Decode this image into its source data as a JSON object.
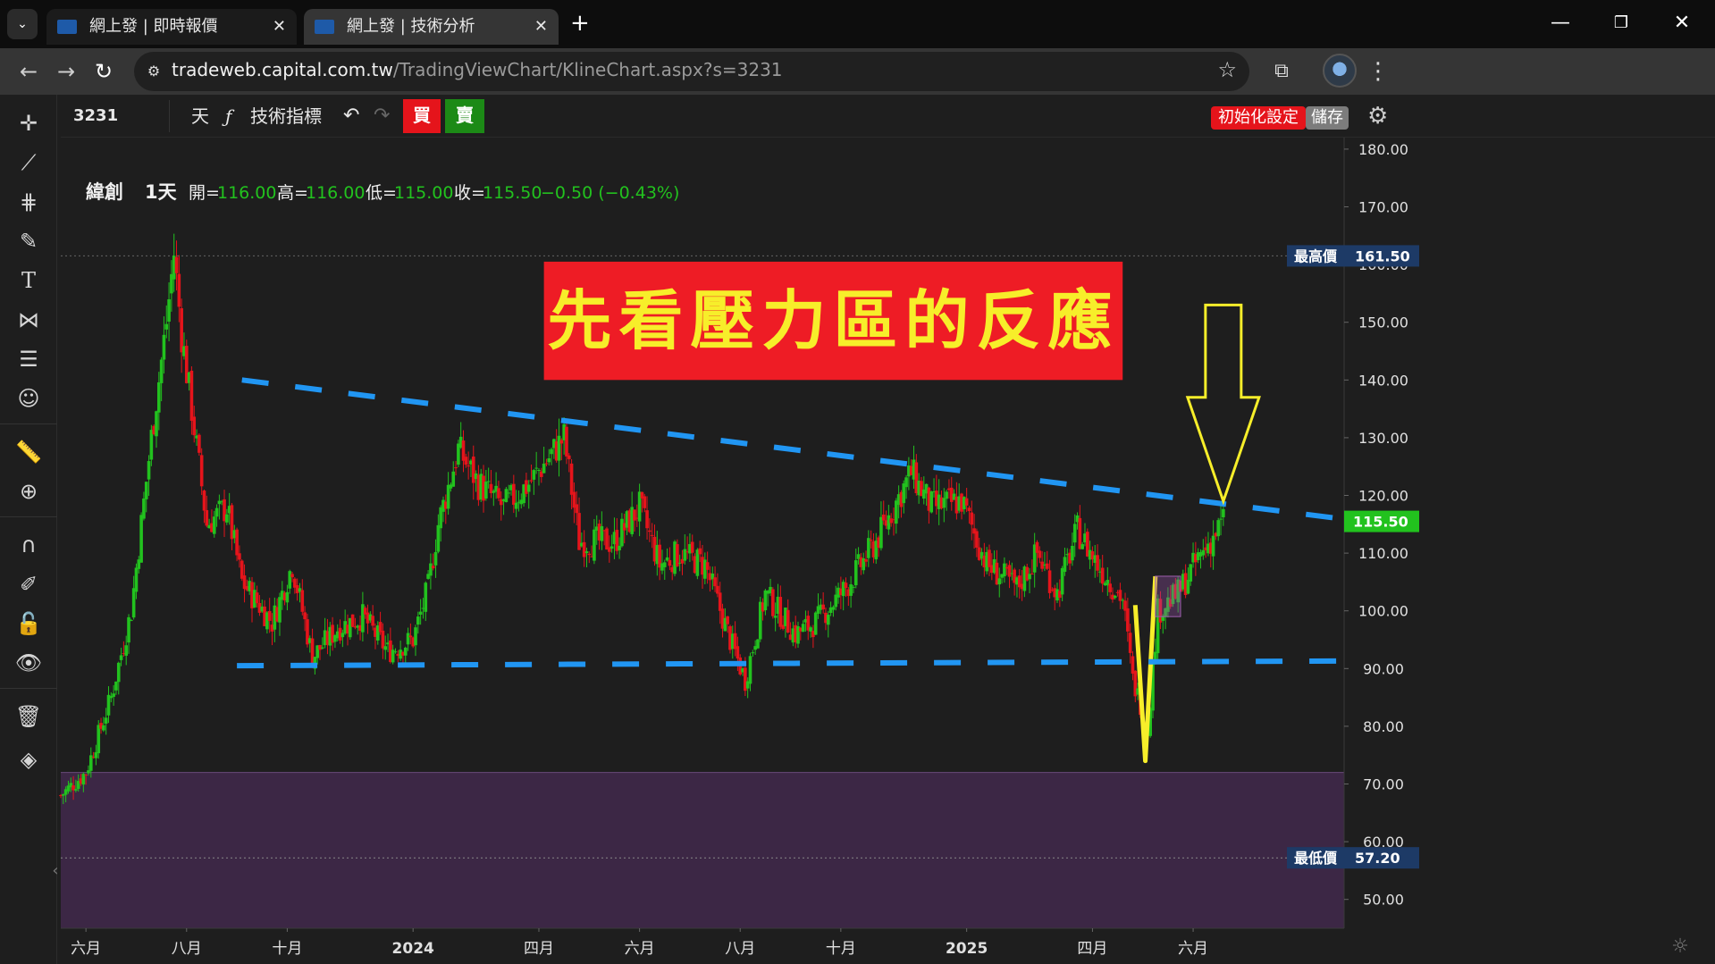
{
  "browser": {
    "tabs": [
      {
        "title": "網上發 | 即時報價",
        "close": "✕"
      },
      {
        "title": "網上發 | 技術分析",
        "close": "✕"
      }
    ],
    "new_tab": "+",
    "url_host": "tradeweb.capital.com.tw",
    "url_path": "/TradingViewChart/KlineChart.aspx?s=3231"
  },
  "chart_toolbar": {
    "symbol": "3231",
    "interval": "天",
    "indicators_label": "技術指標",
    "buy_label": "買",
    "sell_label": "賣",
    "reset_label": "初始化設定",
    "save_label": "儲存"
  },
  "legend": {
    "name": "緯創",
    "interval": "1天",
    "open_label": "開=",
    "open": "116.00",
    "high_label": "高=",
    "high": "116.00",
    "low_label": "低=",
    "low": "115.00",
    "close_label": "收=",
    "close": "115.50",
    "change": "−0.50 (−0.43%)"
  },
  "annotation_text": "先看壓力區的反應",
  "colors": {
    "up": "#22c21e",
    "down": "#e5141b",
    "trendline": "#2196f3",
    "annotation_bg": "#ee1c25",
    "annotation_text": "#f7ee2a",
    "arrow": "#f7ee2a",
    "zone": "#3c2745"
  },
  "chart_data": {
    "type": "candlestick",
    "y_range": [
      45,
      182
    ],
    "y_ticks": [
      "50.00",
      "60.00",
      "70.00",
      "80.00",
      "90.00",
      "100.00",
      "110.00",
      "120.00",
      "130.00",
      "140.00",
      "150.00",
      "160.00",
      "170.00",
      "180.00"
    ],
    "y_tick_values": [
      50,
      60,
      70,
      80,
      90,
      100,
      110,
      120,
      130,
      140,
      150,
      160,
      170,
      180
    ],
    "x_ticks": [
      "六月",
      "八月",
      "十月",
      "2024",
      "四月",
      "六月",
      "八月",
      "十月",
      "2025",
      "四月",
      "六月"
    ],
    "x_tick_positions": [
      0.5,
      2.5,
      4.5,
      7,
      9.5,
      11.5,
      13.5,
      15.5,
      18,
      20.5,
      22.5
    ],
    "x_range": [
      0,
      25.5
    ],
    "high_label": "最高價",
    "high_price": "161.50",
    "high_value": 161.5,
    "low_label": "最低價",
    "low_price": "57.20",
    "low_value": 57.2,
    "last_price": "115.50",
    "last_value": 115.5,
    "zone_range": [
      45,
      72
    ],
    "resistance_line": [
      [
        3.6,
        140
      ],
      [
        25.4,
        116
      ]
    ],
    "support_line": [
      [
        3.5,
        90.5
      ],
      [
        25.4,
        91.3
      ]
    ],
    "series_anchors": [
      [
        0,
        68
      ],
      [
        0.5,
        72
      ],
      [
        1.0,
        85
      ],
      [
        1.4,
        100
      ],
      [
        1.8,
        130
      ],
      [
        2.1,
        150
      ],
      [
        2.25,
        162
      ],
      [
        2.4,
        148
      ],
      [
        2.6,
        135
      ],
      [
        2.9,
        115
      ],
      [
        3.3,
        118
      ],
      [
        3.6,
        105
      ],
      [
        4.2,
        98
      ],
      [
        4.6,
        108
      ],
      [
        5.0,
        92
      ],
      [
        5.5,
        97
      ],
      [
        6.0,
        99
      ],
      [
        6.5,
        93
      ],
      [
        7.0,
        95
      ],
      [
        7.3,
        104
      ],
      [
        7.5,
        115
      ],
      [
        7.9,
        128
      ],
      [
        8.3,
        122
      ],
      [
        8.8,
        118
      ],
      [
        9.3,
        122
      ],
      [
        10.0,
        130
      ],
      [
        10.3,
        112
      ],
      [
        11.0,
        112
      ],
      [
        11.5,
        118
      ],
      [
        11.9,
        108
      ],
      [
        12.3,
        110
      ],
      [
        12.8,
        108
      ],
      [
        13.3,
        95
      ],
      [
        13.6,
        88
      ],
      [
        14.0,
        103
      ],
      [
        14.6,
        96
      ],
      [
        15.0,
        98
      ],
      [
        15.6,
        104
      ],
      [
        16.2,
        112
      ],
      [
        16.9,
        124
      ],
      [
        17.3,
        118
      ],
      [
        17.9,
        119
      ],
      [
        18.4,
        108
      ],
      [
        19.0,
        104
      ],
      [
        19.4,
        110
      ],
      [
        19.8,
        103
      ],
      [
        20.2,
        114
      ],
      [
        20.6,
        108
      ],
      [
        21.1,
        102
      ],
      [
        21.3,
        88
      ],
      [
        21.6,
        80
      ],
      [
        21.8,
        100
      ],
      [
        22.2,
        103
      ],
      [
        22.6,
        109
      ],
      [
        23.1,
        115.5
      ]
    ],
    "dip_wick": [
      [
        21.35,
        101
      ],
      [
        21.55,
        74
      ],
      [
        21.75,
        106
      ]
    ],
    "arrow": {
      "x": 23.1,
      "top": 153,
      "bottom": 119,
      "head_y": 137
    },
    "box": {
      "x1": 21.75,
      "x2": 22.25,
      "y1": 99,
      "y2": 106
    },
    "annotation_box": {
      "x1": 9.6,
      "x2": 21.1,
      "y1": 160.5,
      "y2": 140
    }
  }
}
